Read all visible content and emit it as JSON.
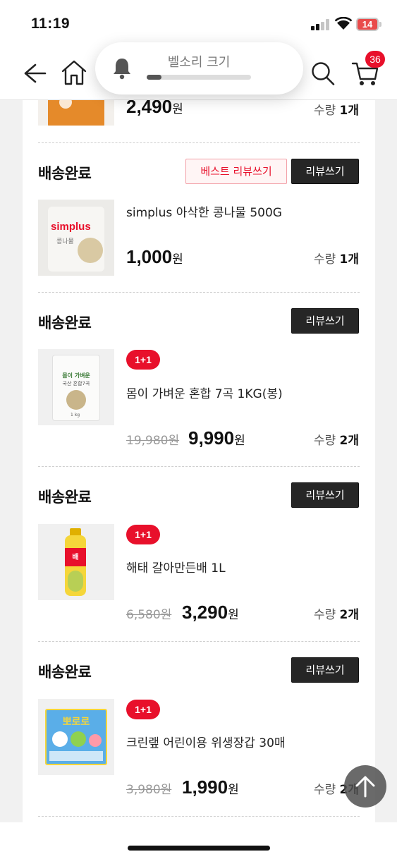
{
  "status_bar": {
    "time": "11:19",
    "battery": "14"
  },
  "nav": {
    "cart_count": "36"
  },
  "bell_popup": {
    "label": "벨소리 크기",
    "level": 0.14
  },
  "first_item": {
    "price": "2,490",
    "won": "원",
    "qty_label": "수량",
    "qty": "1개"
  },
  "orders": [
    {
      "status": "배송완료",
      "best_review": "베스트 리뷰쓰기",
      "review": "리뷰쓰기",
      "name": "simplus 아삭한 콩나물 500G",
      "price": "1,000",
      "won": "원",
      "qty_label": "수량",
      "qty": "1개",
      "thumb_brand": "simplus",
      "thumb_sub": "콩나물"
    },
    {
      "status": "배송완료",
      "review": "리뷰쓰기",
      "tag": "1+1",
      "name": "몸이 가벼운 혼합 7곡 1KG(봉)",
      "orig": "19,980원",
      "price": "9,990",
      "won": "원",
      "qty_label": "수량",
      "qty": "2개",
      "thumb_title": "몸이 가벼운",
      "thumb_sub": "국산 혼합7곡",
      "thumb_weight": "1 kg"
    },
    {
      "status": "배송완료",
      "review": "리뷰쓰기",
      "tag": "1+1",
      "name": "해태 갈아만든배 1L",
      "orig": "6,580원",
      "price": "3,290",
      "won": "원",
      "qty_label": "수량",
      "qty": "2개",
      "thumb_label": "배"
    },
    {
      "status": "배송완료",
      "review": "리뷰쓰기",
      "tag": "1+1",
      "name": "크린랲 어린이용 위생장갑 30매",
      "orig": "3,980원",
      "price": "1,990",
      "won": "원",
      "qty_label": "수량",
      "qty": "2개",
      "thumb_label": "뽀로로"
    }
  ],
  "colors": {
    "accent": "#e8102b",
    "dark_button": "#262626"
  }
}
